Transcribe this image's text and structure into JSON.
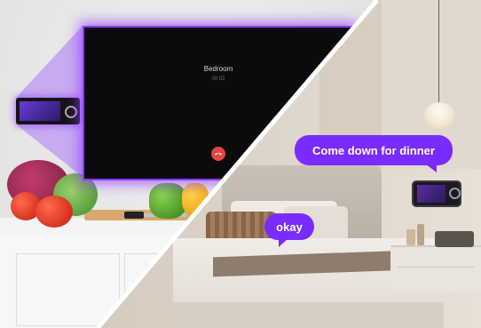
{
  "call_screen": {
    "caller_name": "Bedroom",
    "call_timer": "00:02",
    "hangup_icon": "phone-hangup-icon",
    "accent_color": "#8d3cff",
    "hangup_color": "#e5453c"
  },
  "bubbles": {
    "dinner_text": "Come down for dinner",
    "reply_text": "okay",
    "bubble_color": "#7a2bff"
  }
}
